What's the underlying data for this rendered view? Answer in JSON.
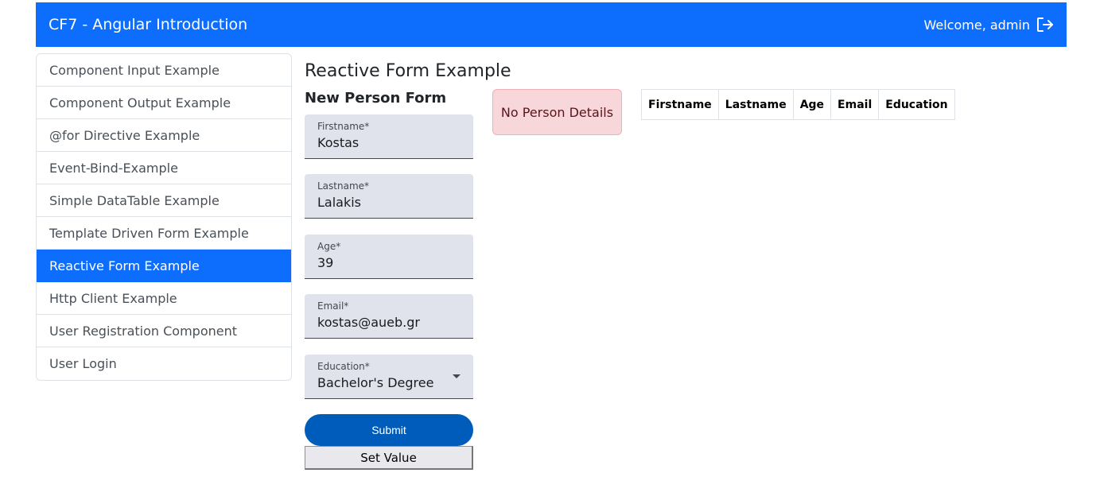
{
  "navbar": {
    "brand": "CF7 - Angular Introduction",
    "welcome": "Welcome, admin",
    "logout_icon": "logout-icon"
  },
  "sidebar": {
    "items": [
      {
        "label": "Component Input Example"
      },
      {
        "label": "Component Output Example"
      },
      {
        "label": "@for Directive Example"
      },
      {
        "label": "Event-Bind-Example"
      },
      {
        "label": "Simple DataTable Example"
      },
      {
        "label": "Template Driven Form Example"
      },
      {
        "label": "Reactive Form Example",
        "active": true
      },
      {
        "label": "Http Client Example"
      },
      {
        "label": "User Registration Component"
      },
      {
        "label": "User Login"
      }
    ]
  },
  "main": {
    "title": "Reactive Form Example",
    "form": {
      "title": "New Person Form",
      "firstname": {
        "label": "Firstname*",
        "value": "Kostas"
      },
      "lastname": {
        "label": "Lastname*",
        "value": "Lalakis"
      },
      "age": {
        "label": "Age*",
        "value": "39"
      },
      "email": {
        "label": "Email*",
        "value": "kostas@aueb.gr"
      },
      "education": {
        "label": "Education*",
        "value": "Bachelor's Degree"
      },
      "submit_label": "Submit",
      "set_value_label": "Set Value"
    },
    "alert": {
      "text": "No Person Details"
    },
    "table": {
      "headers": [
        "Firstname",
        "Lastname",
        "Age",
        "Email",
        "Education"
      ]
    }
  },
  "colors": {
    "primary": "#0d6efd",
    "submit": "#005cbb",
    "alert_bg": "#f8d7da",
    "field_bg": "#e0e2ec"
  }
}
